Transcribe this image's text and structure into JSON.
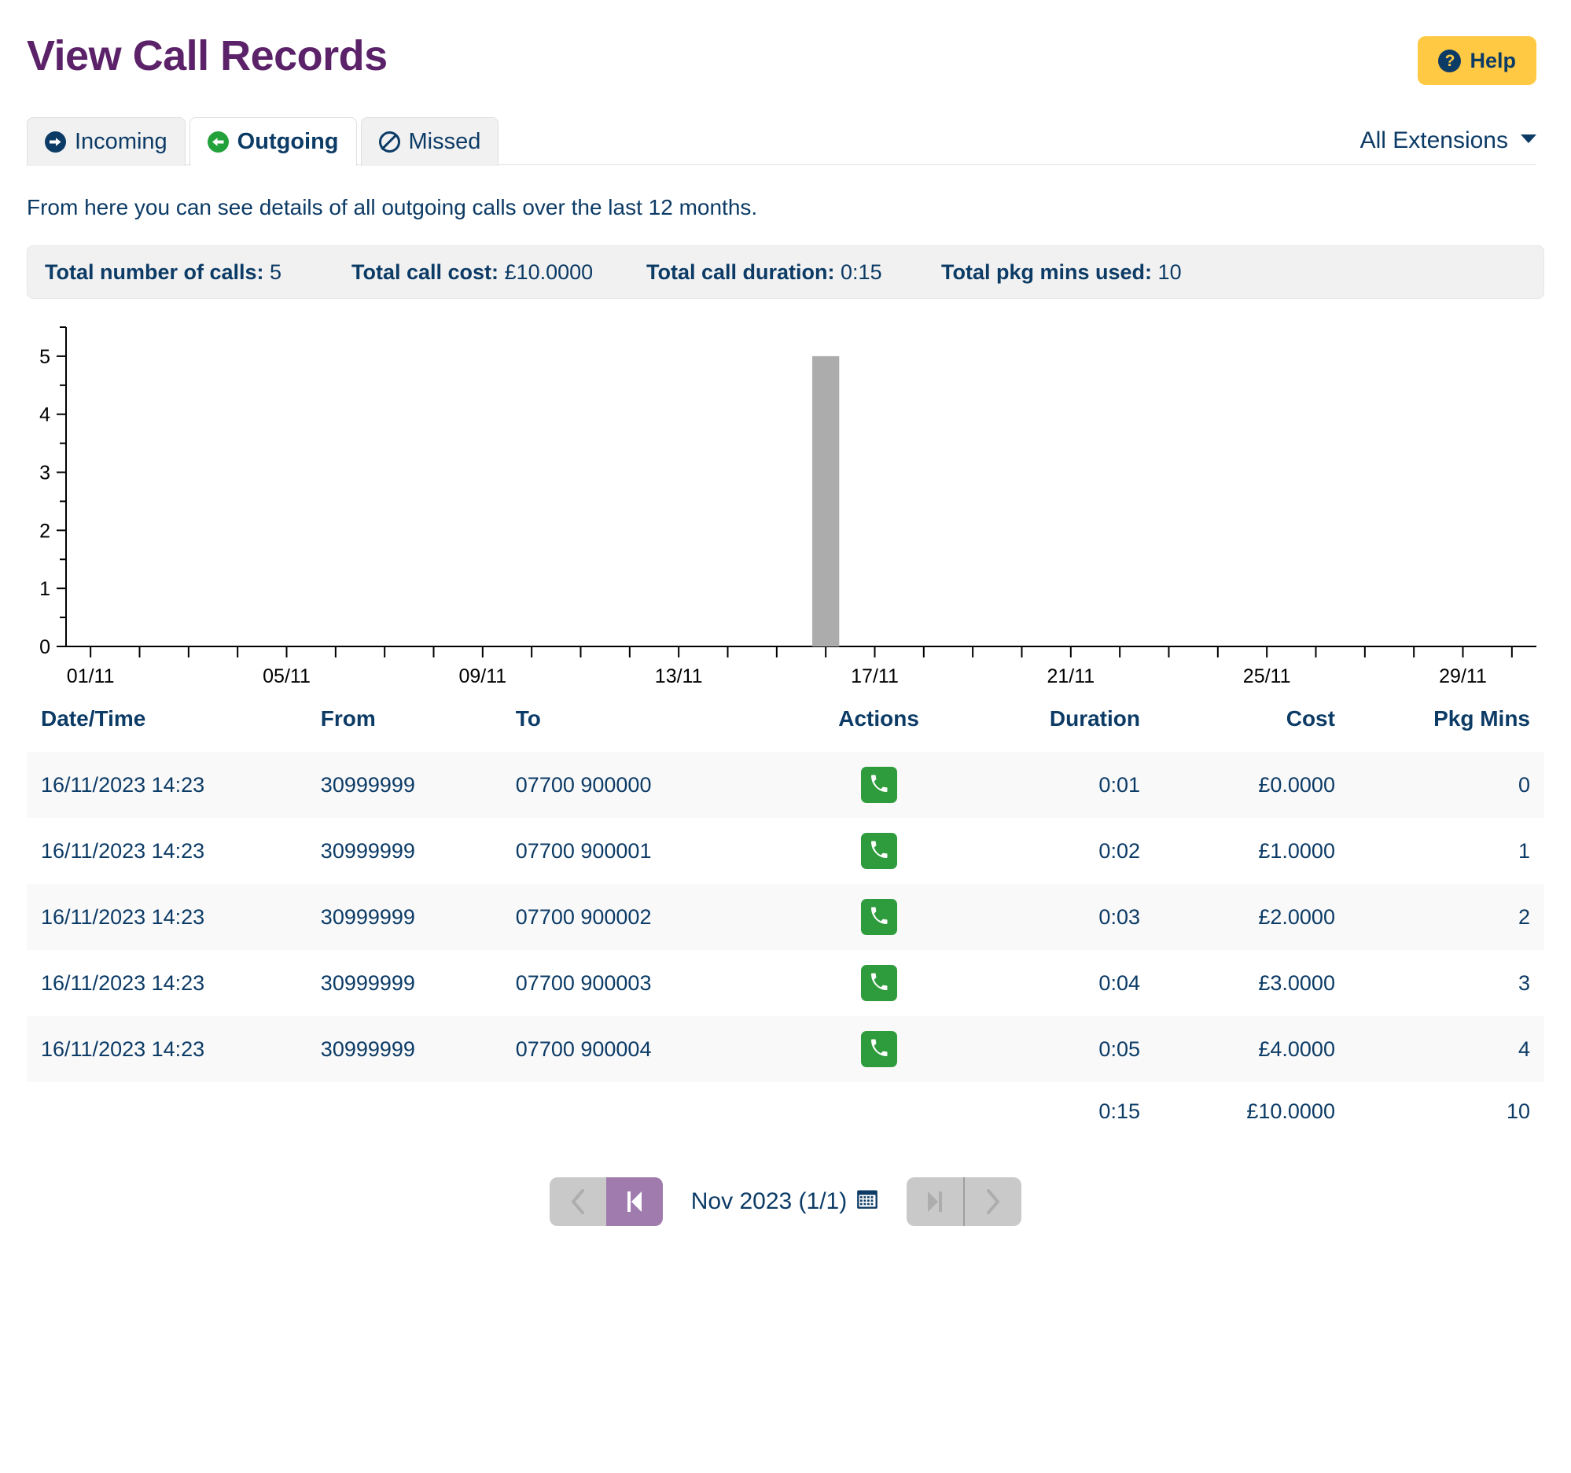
{
  "header": {
    "title": "View Call Records",
    "help_label": "Help",
    "help_icon": "question-circle-icon"
  },
  "tabs": [
    {
      "label": "Incoming",
      "icon": "arrow-circle-right-icon",
      "active": false
    },
    {
      "label": "Outgoing",
      "icon": "arrow-circle-left-icon",
      "active": true
    },
    {
      "label": "Missed",
      "icon": "ban-icon",
      "active": false
    }
  ],
  "extension_filter": {
    "label": "All Extensions",
    "icon": "chevron-down-icon"
  },
  "description": "From here you can see details of all outgoing calls over the last 12 months.",
  "summary": [
    {
      "label": "Total number of calls:",
      "value": "5"
    },
    {
      "label": "Total call cost:",
      "value": "£10.0000"
    },
    {
      "label": "Total call duration:",
      "value": "0:15"
    },
    {
      "label": "Total pkg mins used:",
      "value": "10"
    }
  ],
  "chart_data": {
    "type": "bar",
    "title": "",
    "xlabel": "",
    "ylabel": "",
    "ylim": [
      0,
      5.5
    ],
    "yticks": [
      0,
      1,
      2,
      3,
      4,
      5
    ],
    "ytick_labels": [
      "0",
      "1",
      "2",
      "3",
      "4",
      "5"
    ],
    "minor_yticks": [
      0.5,
      1.5,
      2.5,
      3.5,
      4.5,
      5.5
    ],
    "grid": false,
    "bar_color": "#ACACAC",
    "x_start": "01/11",
    "x_end": "30/11",
    "x_tick_labels": [
      "01/11",
      "05/11",
      "09/11",
      "13/11",
      "17/11",
      "21/11",
      "25/11",
      "29/11"
    ],
    "x_tick_positions": [
      1,
      5,
      9,
      13,
      17,
      21,
      25,
      29
    ],
    "categories": [
      "01/11",
      "02/11",
      "03/11",
      "04/11",
      "05/11",
      "06/11",
      "07/11",
      "08/11",
      "09/11",
      "10/11",
      "11/11",
      "12/11",
      "13/11",
      "14/11",
      "15/11",
      "16/11",
      "17/11",
      "18/11",
      "19/11",
      "20/11",
      "21/11",
      "22/11",
      "23/11",
      "24/11",
      "25/11",
      "26/11",
      "27/11",
      "28/11",
      "29/11",
      "30/11"
    ],
    "values": [
      0,
      0,
      0,
      0,
      0,
      0,
      0,
      0,
      0,
      0,
      0,
      0,
      0,
      0,
      0,
      5,
      0,
      0,
      0,
      0,
      0,
      0,
      0,
      0,
      0,
      0,
      0,
      0,
      0,
      0
    ]
  },
  "table": {
    "columns": [
      "Date/Time",
      "From",
      "To",
      "Actions",
      "Duration",
      "Cost",
      "Pkg Mins"
    ],
    "rows": [
      {
        "datetime": "16/11/2023 14:23",
        "from": "30999999",
        "to": "07700 900000",
        "action_icon": "phone-icon",
        "duration": "0:01",
        "cost": "£0.0000",
        "pkg_mins": "0"
      },
      {
        "datetime": "16/11/2023 14:23",
        "from": "30999999",
        "to": "07700 900001",
        "action_icon": "phone-icon",
        "duration": "0:02",
        "cost": "£1.0000",
        "pkg_mins": "1"
      },
      {
        "datetime": "16/11/2023 14:23",
        "from": "30999999",
        "to": "07700 900002",
        "action_icon": "phone-icon",
        "duration": "0:03",
        "cost": "£2.0000",
        "pkg_mins": "2"
      },
      {
        "datetime": "16/11/2023 14:23",
        "from": "30999999",
        "to": "07700 900003",
        "action_icon": "phone-icon",
        "duration": "0:04",
        "cost": "£3.0000",
        "pkg_mins": "3"
      },
      {
        "datetime": "16/11/2023 14:23",
        "from": "30999999",
        "to": "07700 900004",
        "action_icon": "phone-icon",
        "duration": "0:05",
        "cost": "£4.0000",
        "pkg_mins": "4"
      }
    ],
    "totals": {
      "duration": "0:15",
      "cost": "£10.0000",
      "pkg_mins": "10"
    }
  },
  "pagination": {
    "prev_icon": "chevron-left-icon",
    "first_icon": "step-backward-icon",
    "label": "Nov 2023 (1/1)",
    "calendar_icon": "calendar-icon",
    "last_icon": "step-forward-icon",
    "next_icon": "chevron-right-icon"
  },
  "colors": {
    "title_purple": "#5B2269",
    "navy": "#0C3B66",
    "help_yellow": "#FFC943",
    "green": "#2E9B3C",
    "bar_gray": "#ACACAC",
    "pager_active": "#A07BAE"
  }
}
